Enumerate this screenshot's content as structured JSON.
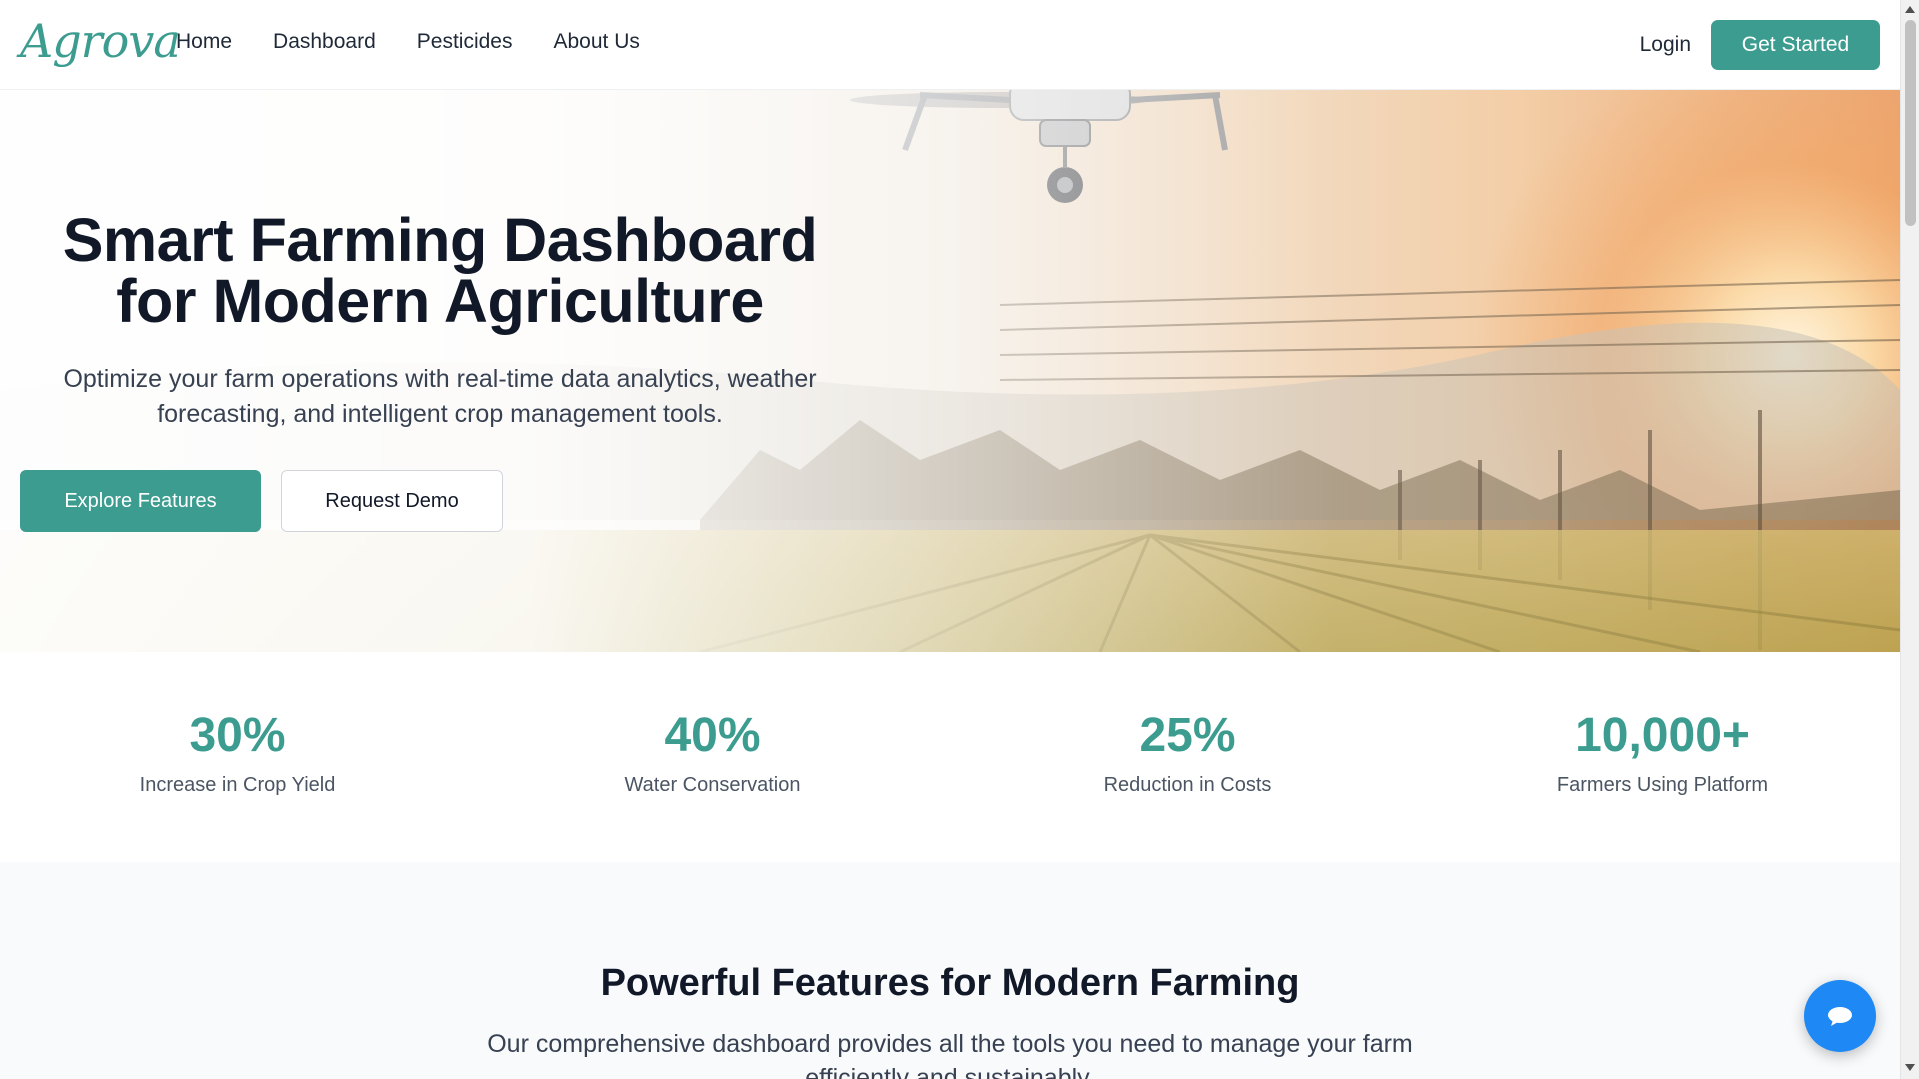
{
  "nav": {
    "brand": "Agrova",
    "links": [
      "Home",
      "Dashboard",
      "Pesticides",
      "About Us"
    ],
    "login": "Login",
    "cta": "Get Started"
  },
  "hero": {
    "title_line1": "Smart Farming Dashboard",
    "title_line2": "for Modern Agriculture",
    "subtitle": "Optimize your farm operations with real-time data analytics, weather forecasting, and intelligent crop management tools.",
    "primary_button": "Explore Features",
    "secondary_button": "Request Demo",
    "background_image": "drone-over-crop-field-at-sunset"
  },
  "stats": [
    {
      "value": "30%",
      "label": "Increase in Crop Yield"
    },
    {
      "value": "40%",
      "label": "Water Conservation"
    },
    {
      "value": "25%",
      "label": "Reduction in Costs"
    },
    {
      "value": "10,000+",
      "label": "Farmers Using Platform"
    }
  ],
  "features": {
    "title": "Powerful Features for Modern Farming",
    "subtitle": "Our comprehensive dashboard provides all the tools you need to manage your farm efficiently and sustainably."
  },
  "chat": {
    "icon": "chat-bubble-icon"
  },
  "colors": {
    "accent": "#3b9c8f",
    "chat": "#1e88f5",
    "text": "#111827"
  }
}
